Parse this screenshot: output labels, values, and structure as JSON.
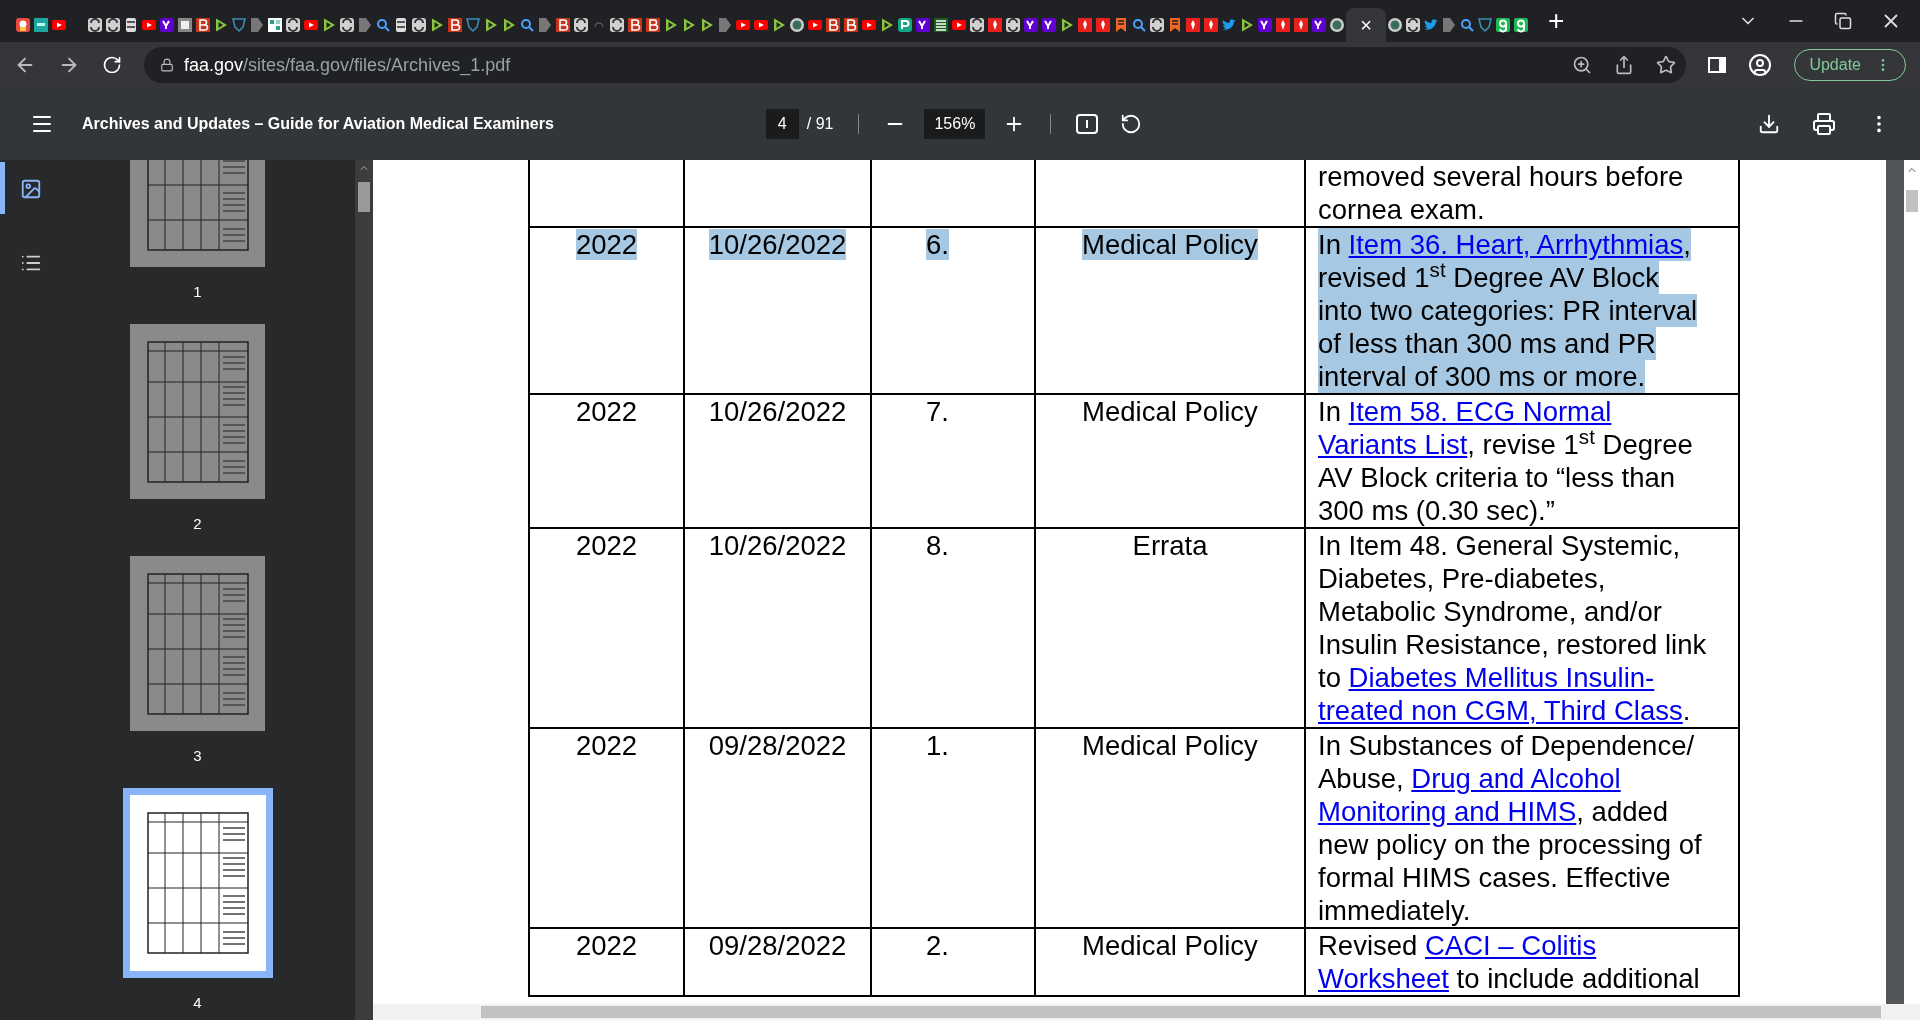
{
  "tabs": [
    {
      "kind": "app",
      "pinned": true,
      "selected": false
    },
    {
      "kind": "square",
      "pinned": true,
      "selected": false
    },
    {
      "kind": "video",
      "pinned": true,
      "selected": false
    },
    {
      "kind": "swirl",
      "selected": false
    },
    {
      "kind": "swirl",
      "selected": false
    },
    {
      "kind": "jar",
      "selected": false
    },
    {
      "kind": "video",
      "selected": false
    },
    {
      "kind": "yahoo",
      "selected": false
    },
    {
      "kind": "grey",
      "selected": false
    },
    {
      "kind": "b",
      "selected": false
    },
    {
      "kind": "play",
      "selected": false
    },
    {
      "kind": "shield",
      "selected": false
    },
    {
      "kind": "chevron",
      "selected": false
    },
    {
      "kind": "grid",
      "selected": false
    },
    {
      "kind": "swirl",
      "selected": false
    },
    {
      "kind": "video",
      "selected": false
    },
    {
      "kind": "play",
      "selected": false
    },
    {
      "kind": "swirl",
      "selected": false
    },
    {
      "kind": "chevron",
      "selected": false
    },
    {
      "kind": "search",
      "selected": false
    },
    {
      "kind": "jar",
      "selected": false
    },
    {
      "kind": "swirl",
      "selected": false
    },
    {
      "kind": "play",
      "selected": false
    },
    {
      "kind": "b",
      "selected": false
    },
    {
      "kind": "shield",
      "selected": false
    },
    {
      "kind": "play",
      "selected": false
    },
    {
      "kind": "play",
      "selected": false
    },
    {
      "kind": "search",
      "selected": false
    },
    {
      "kind": "chevron",
      "selected": false
    },
    {
      "kind": "b",
      "selected": false
    },
    {
      "kind": "swirl",
      "selected": false
    },
    {
      "kind": "blank",
      "selected": false
    },
    {
      "kind": "swirl",
      "selected": false
    },
    {
      "kind": "b",
      "selected": false
    },
    {
      "kind": "b",
      "selected": false
    },
    {
      "kind": "play",
      "selected": false
    },
    {
      "kind": "play",
      "selected": false
    },
    {
      "kind": "play",
      "selected": false
    },
    {
      "kind": "chevron",
      "selected": false
    },
    {
      "kind": "video",
      "selected": false
    },
    {
      "kind": "video",
      "selected": false
    },
    {
      "kind": "play",
      "selected": false
    },
    {
      "kind": "seal",
      "selected": false
    },
    {
      "kind": "video",
      "selected": false
    },
    {
      "kind": "b",
      "selected": false
    },
    {
      "kind": "b",
      "selected": false
    },
    {
      "kind": "video",
      "selected": false
    },
    {
      "kind": "play",
      "selected": false
    },
    {
      "kind": "pj",
      "selected": false
    },
    {
      "kind": "yahoo",
      "selected": false
    },
    {
      "kind": "list",
      "selected": false
    },
    {
      "kind": "video",
      "selected": false
    },
    {
      "kind": "swirl",
      "selected": false
    },
    {
      "kind": "pin",
      "selected": false
    },
    {
      "kind": "swirl",
      "selected": false
    },
    {
      "kind": "yahoo",
      "selected": false
    },
    {
      "kind": "yahoo",
      "selected": false
    },
    {
      "kind": "play",
      "selected": false
    },
    {
      "kind": "pin",
      "selected": false
    },
    {
      "kind": "pin",
      "selected": false
    },
    {
      "kind": "bookmark",
      "selected": false
    },
    {
      "kind": "search",
      "selected": false
    },
    {
      "kind": "swirl",
      "selected": false
    },
    {
      "kind": "bookmark",
      "selected": false
    },
    {
      "kind": "pin",
      "selected": false
    },
    {
      "kind": "pin",
      "selected": false
    },
    {
      "kind": "bird",
      "selected": false
    },
    {
      "kind": "play",
      "selected": false
    },
    {
      "kind": "yahoo",
      "selected": false
    },
    {
      "kind": "pin",
      "selected": false
    },
    {
      "kind": "pin",
      "selected": false
    },
    {
      "kind": "yahoo",
      "selected": false
    },
    {
      "kind": "seal",
      "selected": false
    },
    {
      "selected": true,
      "close": "×"
    },
    {
      "kind": "seal",
      "selected": false
    },
    {
      "kind": "swirl",
      "selected": false
    },
    {
      "kind": "bird",
      "selected": false
    },
    {
      "kind": "chevron",
      "selected": false
    },
    {
      "kind": "search",
      "selected": false
    },
    {
      "kind": "shield",
      "selected": false
    },
    {
      "kind": "g",
      "selected": false
    },
    {
      "kind": "g",
      "selected": false
    }
  ],
  "new_tab": "+",
  "address_bar": {
    "domain": "faa.gov",
    "path": "/sites/faa.gov/files/Archives_1.pdf",
    "update_button": "Update"
  },
  "pdf_toolbar": {
    "title": "Archives and Updates – Guide for Aviation Medical Examiners",
    "page": "4",
    "page_count": "/ 91",
    "zoom": "156%"
  },
  "sidebar": {
    "views": [
      {
        "kind": "thumbnails",
        "selected": true
      },
      {
        "kind": "outline",
        "selected": false
      }
    ],
    "thumbnails": [
      {
        "label": "1",
        "selected": false
      },
      {
        "label": "2",
        "selected": false
      },
      {
        "label": "3",
        "selected": false
      },
      {
        "label": "4",
        "selected": true
      }
    ]
  },
  "table": {
    "rows": [
      {
        "year": "",
        "date": "",
        "number": "",
        "category": "",
        "highlighted": false,
        "description": [
          [
            {
              "text": "removed several hours before"
            }
          ],
          [
            {
              "text": "cornea exam."
            }
          ]
        ]
      },
      {
        "year": "2022",
        "date": "10/26/2022",
        "number": "6.",
        "category": "Medical Policy",
        "highlighted": true,
        "description": [
          [
            {
              "text": "In "
            },
            {
              "text": "Item 36. Heart, Arrhythmias",
              "link": true
            },
            {
              "text": ","
            }
          ],
          [
            {
              "text": "revised 1$^{st}$ Degree AV Block"
            }
          ],
          [
            {
              "text": "into two categories: PR interval"
            }
          ],
          [
            {
              "text": "of less than 300 ms and PR"
            }
          ],
          [
            {
              "text": "interval of 300 ms or more."
            }
          ]
        ]
      },
      {
        "year": "2022",
        "date": "10/26/2022",
        "number": "7.",
        "category": "Medical Policy",
        "highlighted": false,
        "description": [
          [
            {
              "text": "In "
            },
            {
              "text": "Item 58. ECG Normal",
              "link": true
            }
          ],
          [
            {
              "text": "Variants List",
              "link": true
            },
            {
              "text": ", revise 1$^{st}$ Degree"
            }
          ],
          [
            {
              "text": "AV Block criteria to “less than"
            }
          ],
          [
            {
              "text": "300 ms (0.30 sec).”"
            }
          ]
        ]
      },
      {
        "year": "2022",
        "date": "10/26/2022",
        "number": "8.",
        "category": "Errata",
        "highlighted": false,
        "description": [
          [
            {
              "text": "In Item 48. General Systemic,"
            }
          ],
          [
            {
              "text": "Diabetes, Pre-diabetes,"
            }
          ],
          [
            {
              "text": "Metabolic Syndrome, and/or"
            }
          ],
          [
            {
              "text": "Insulin Resistance, restored link"
            }
          ],
          [
            {
              "text": "to "
            },
            {
              "text": "Diabetes Mellitus Insulin-",
              "link": true
            }
          ],
          [
            {
              "text": "treated non CGM, Third Class",
              "link": true
            },
            {
              "text": "."
            }
          ]
        ]
      },
      {
        "year": "2022",
        "date": "09/28/2022",
        "number": "1.",
        "category": "Medical Policy",
        "highlighted": false,
        "description": [
          [
            {
              "text": "In Substances of Dependence/"
            }
          ],
          [
            {
              "text": "Abuse, "
            },
            {
              "text": "Drug and Alcohol",
              "link": true
            }
          ],
          [
            {
              "text": "Monitoring and HIMS",
              "link": true
            },
            {
              "text": ", added"
            }
          ],
          [
            {
              "text": "new policy on the processing of"
            }
          ],
          [
            {
              "text": "formal HIMS cases. Effective"
            }
          ],
          [
            {
              "text": "immediately."
            }
          ]
        ]
      },
      {
        "year": "2022",
        "date": "09/28/2022",
        "number": "2.",
        "category": "Medical Policy",
        "highlighted": false,
        "description": [
          [
            {
              "text": "Revised "
            },
            {
              "text": "CACI – Colitis",
              "link": true
            }
          ],
          [
            {
              "text": "Worksheet",
              "link": true
            },
            {
              "text": " to include additional"
            }
          ]
        ]
      }
    ]
  }
}
